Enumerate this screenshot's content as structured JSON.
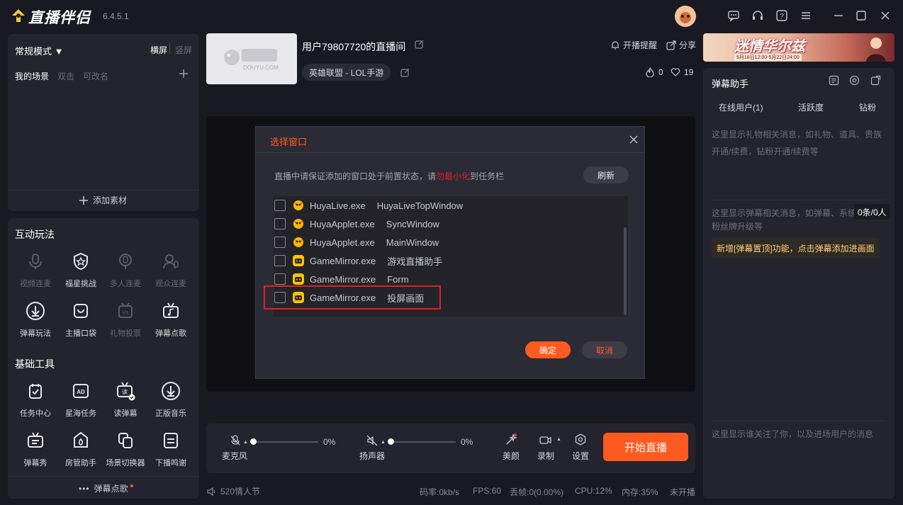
{
  "app": {
    "logo_text": "直播伴侣",
    "version": "6.4.5.1",
    "window_controls": [
      "message-icon",
      "headset-icon",
      "help-icon",
      "menu-icon",
      "minimize-icon",
      "maximize-icon",
      "close-icon"
    ]
  },
  "left_scene": {
    "mode_label": "常规模式 ▼",
    "orient_h": "横屏",
    "orient_v": "竖屏",
    "scene_title": "我的场景",
    "scene_hint1": "双击",
    "scene_hint2": "可改名",
    "add_material": "添加素材"
  },
  "interactive": {
    "title": "互动玩法",
    "items": [
      {
        "label": "视频连麦",
        "icon": "mic-icon",
        "enabled": false
      },
      {
        "label": "福星挑战",
        "icon": "shield-star-icon",
        "enabled": true
      },
      {
        "label": "多人连麦",
        "icon": "multi-mic-icon",
        "enabled": false
      },
      {
        "label": "观众连麦",
        "icon": "audience-icon",
        "enabled": false
      },
      {
        "label": "弹幕玩法",
        "icon": "download-icon",
        "enabled": true
      },
      {
        "label": "主播口袋",
        "icon": "pocket-icon",
        "enabled": true
      },
      {
        "label": "礼物投票",
        "icon": "vote-icon",
        "enabled": false
      },
      {
        "label": "弹幕点歌",
        "icon": "music-tv-icon",
        "enabled": true
      }
    ]
  },
  "tools": {
    "title": "基础工具",
    "items": [
      {
        "label": "任务中心",
        "icon": "task-icon"
      },
      {
        "label": "星海任务",
        "icon": "ad-icon"
      },
      {
        "label": "读弹幕",
        "icon": "read-danmu-icon"
      },
      {
        "label": "正版音乐",
        "icon": "download-circle-icon"
      },
      {
        "label": "弹幕秀",
        "icon": "tv-text-icon"
      },
      {
        "label": "房管助手",
        "icon": "house-guard-icon"
      },
      {
        "label": "场景切换器",
        "icon": "switch-icon"
      },
      {
        "label": "下播鸣谢",
        "icon": "thanks-icon"
      }
    ],
    "footer": "弹幕点歌"
  },
  "room": {
    "title": "用户79807720的直播间",
    "category": "英雄联盟 - LOL手游",
    "reminder": "开播提醒",
    "share": "分享",
    "hot_count": "0",
    "like_count": "19",
    "thumb_text": "DOUYU.COM"
  },
  "banner": {
    "title": "迷情华尔兹",
    "date": "5月18日12:00-5月22日24:00"
  },
  "dialog": {
    "title": "选择窗口",
    "hint_before": "直播中请保证添加的窗口处于前置状态，请",
    "hint_red": "勿最小化",
    "hint_after": "到任务栏",
    "refresh": "刷新",
    "rows": [
      {
        "exe": "HuyaLive.exe",
        "title": "HuyaLiveTopWindow",
        "kind": "huya"
      },
      {
        "exe": "HuyaApplet.exe",
        "title": "SyncWindow",
        "kind": "huya"
      },
      {
        "exe": "HuyaApplet.exe",
        "title": "MainWindow",
        "kind": "huya"
      },
      {
        "exe": "GameMirror.exe",
        "title": "游戏直播助手",
        "kind": "game"
      },
      {
        "exe": "GameMirror.exe",
        "title": "Form",
        "kind": "game"
      },
      {
        "exe": "GameMirror.exe",
        "title": "投屏画面",
        "kind": "game"
      }
    ],
    "confirm": "确定",
    "cancel": "取消",
    "highlight_color": "#e02020"
  },
  "controls": {
    "mic_label": "麦克风",
    "mic_value": "0%",
    "speaker_label": "扬声器",
    "speaker_value": "0%",
    "beauty": "美颜",
    "record": "录制",
    "settings": "设置",
    "start": "开始直播"
  },
  "danmu": {
    "title": "弹幕助手",
    "tabs": [
      "在线用户(1)",
      "活跃度",
      "钻粉"
    ],
    "gift_msg": "这里显示礼物相关消息，如礼物、道具、贵族开通/续费，钻粉开通/续费等",
    "danmu_msg": "这里显示弹幕相关消息，如弹幕、系统",
    "danmu_msg2": "粉丝牌升级等",
    "count_badge": "0条/0人",
    "notice": "新增[弹幕置顶]功能，点击弹幕添加进画面",
    "follow_msg": "这里显示谁关注了你，以及进场用户的消息"
  },
  "status": {
    "event": "520情人节",
    "bitrate": "码率:0kb/s",
    "fps": "FPS:60",
    "drop": "丢帧:0(0.00%)",
    "cpu": "CPU:12%",
    "mem": "内存:35%",
    "live": "未开播"
  },
  "colors": {
    "accent": "#ff5a1f",
    "bg": "#191922",
    "panel": "#24242e"
  }
}
